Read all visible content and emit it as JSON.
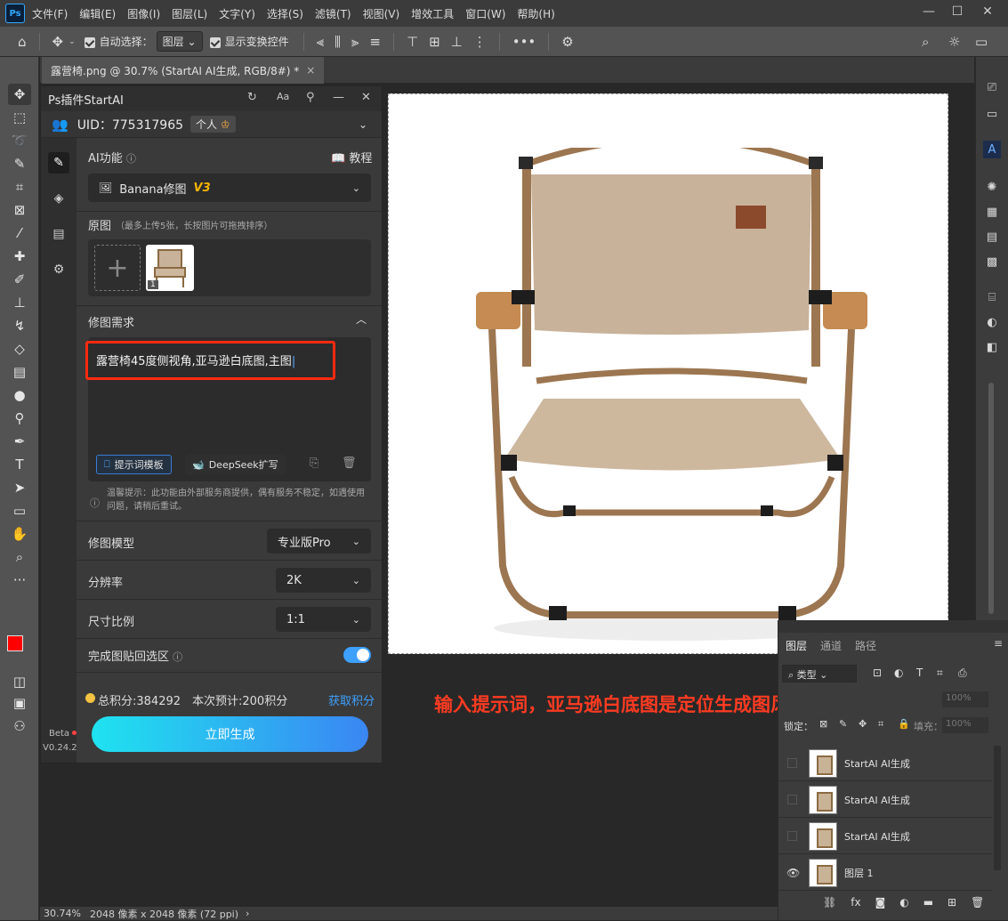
{
  "app": {
    "logo": "Ps"
  },
  "menu": [
    "文件(F)",
    "编辑(E)",
    "图像(I)",
    "图层(L)",
    "文字(Y)",
    "选择(S)",
    "滤镜(T)",
    "视图(V)",
    "增效工具",
    "窗口(W)",
    "帮助(H)"
  ],
  "options": {
    "auto_select": "自动选择：",
    "layer_select": "图层",
    "show_transform": "显示变换控件",
    "more": "•••"
  },
  "document_tab": {
    "title": "露营椅.png @ 30.7% (StartAI AI生成, RGB/8#) *",
    "close": "×"
  },
  "plugin": {
    "title": "Ps插件StartAI",
    "uid_label": "UID：775317965",
    "account_type": "个人",
    "ai_function_label": "AI功能",
    "tutorial": "教程",
    "ai_function_value": "Banana修图",
    "ai_function_version": "V3",
    "source_label": "原图",
    "source_hint": "（最多上传5张，长按图片可拖拽排序）",
    "thumb_badge": "1",
    "requirement_label": "修图需求",
    "prompt_text": "露营椅45度侧视角,亚马逊白底图,主图",
    "template_btn": "提示词模板",
    "deepseek_btn": "DeepSeek扩写",
    "notice": "温馨提示：此功能由外部服务商提供，偶有服务不稳定，如遇使用问题，请稍后重试。",
    "model_label": "修图模型",
    "model_value": "专业版Pro",
    "resolution_label": "分辨率",
    "resolution_value": "2K",
    "ratio_label": "尺寸比例",
    "ratio_value": "1:1",
    "paste_back_label": "完成图贴回选区",
    "paste_back_on": true,
    "points_total": "总积分:384292",
    "points_cost": "本次预计:200积分",
    "get_points": "获取积分",
    "generate_btn": "立即生成",
    "beta": "Beta",
    "version": "V0.24.2"
  },
  "annotation": "输入提示词，亚马逊白底图是定位生成图风格的",
  "layers_panel": {
    "tabs": [
      "图层",
      "通道",
      "路径"
    ],
    "filter": "类型",
    "opacity_value": "100%",
    "lock_label": "锁定：",
    "fill_label": "填充：",
    "fill_value": "100%",
    "layers": [
      {
        "name": "StartAI AI生成",
        "visible": false
      },
      {
        "name": "StartAI AI生成",
        "visible": false
      },
      {
        "name": "StartAI AI生成",
        "visible": false
      },
      {
        "name": "图层 1",
        "visible": true
      }
    ]
  },
  "statusbar": {
    "zoom": "30.74%",
    "size": "2048 像素 x 2048 像素 (72 ppi)"
  },
  "colors": {
    "accent_gradient_start": "#1fe3f0",
    "accent_gradient_end": "#3a86f2",
    "highlight_red": "#ff2a12",
    "version_gold": "#f5b400",
    "toggle_blue": "#3da0ff",
    "fg_color": "#ff0000"
  }
}
